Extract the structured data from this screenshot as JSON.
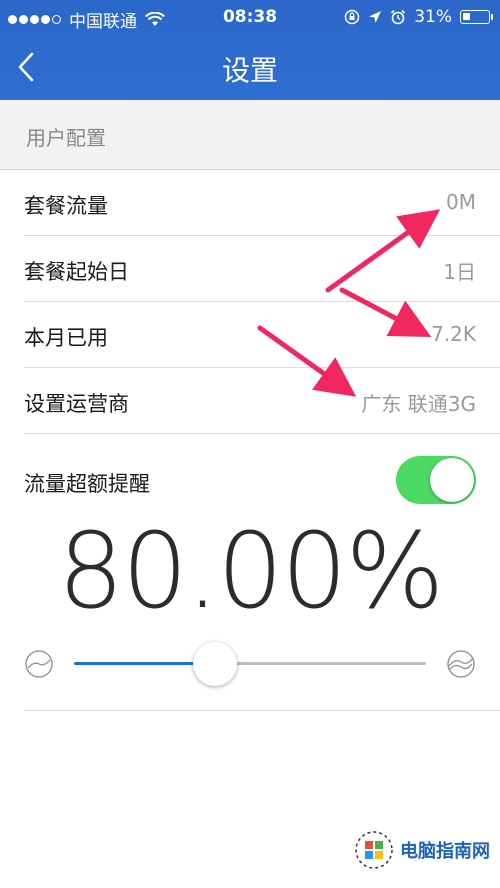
{
  "status_bar": {
    "carrier": "中国联通",
    "time": "08:38",
    "battery_text": "31%",
    "battery_level": 0.31,
    "signal_bars_filled": 4,
    "signal_bars_total": 5
  },
  "nav": {
    "title": "设置",
    "back_icon": "chevron-left-icon"
  },
  "section_header": "用户配置",
  "settings_rows": [
    {
      "label": "套餐流量",
      "value": "0M"
    },
    {
      "label": "套餐起始日",
      "value": "1日"
    },
    {
      "label": "本月已用",
      "value": "7.2K"
    },
    {
      "label": "设置运营商",
      "value": "广东 联通3G"
    }
  ],
  "traffic_alert": {
    "label": "流量超额提醒",
    "enabled": true,
    "percent_text": "80.00%",
    "slider_value": 0.4
  },
  "watermark": "电脑指南网",
  "colors": {
    "header_blue": "#2f6fd0",
    "toggle_green": "#4cd964",
    "slider_blue": "#1e73d6",
    "arrow_pink": "#f0285f"
  }
}
